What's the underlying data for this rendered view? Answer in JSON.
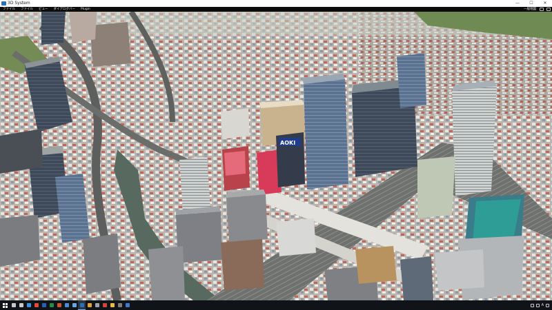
{
  "window": {
    "title": "3D System",
    "controls": {
      "minimize": "—",
      "maximize": "☐",
      "close": "✕"
    }
  },
  "menu": {
    "items": [
      "ファイル",
      "ファイル",
      "ビュー",
      "ダイアログバー",
      "Plugin"
    ],
    "user_label": "一般地図"
  },
  "viewport": {
    "billboards": [
      "AOKI"
    ]
  },
  "taskbar": {
    "apps": [
      {
        "icon": "search-icon",
        "color": "#c8c8c8"
      },
      {
        "icon": "task-view-icon",
        "color": "#c8c8c8"
      },
      {
        "icon": "edge-icon",
        "color": "#3d8fe0"
      },
      {
        "icon": "media-icon",
        "color": "#e04b3a"
      },
      {
        "icon": "word-icon",
        "color": "#2b5fb8"
      },
      {
        "icon": "excel-icon",
        "color": "#2a8a47"
      },
      {
        "icon": "powerpoint-icon",
        "color": "#d0542a"
      },
      {
        "icon": "mail-icon",
        "color": "#4a8ad6"
      },
      {
        "icon": "calc-icon",
        "color": "#6aa7e0"
      },
      {
        "icon": "3d-system-icon",
        "color": "#2d6fb7",
        "active": true
      },
      {
        "icon": "paint-icon",
        "color": "#e2a23a"
      },
      {
        "icon": "settings-icon",
        "color": "#9aa3ad"
      },
      {
        "icon": "chrome-icon",
        "color": "#d7443a"
      },
      {
        "icon": "folder-icon",
        "color": "#e8b84a"
      },
      {
        "icon": "terminal-icon",
        "color": "#7d7d7d"
      },
      {
        "icon": "store-icon",
        "color": "#4477cc"
      }
    ],
    "tray": {
      "lang": "A"
    }
  }
}
